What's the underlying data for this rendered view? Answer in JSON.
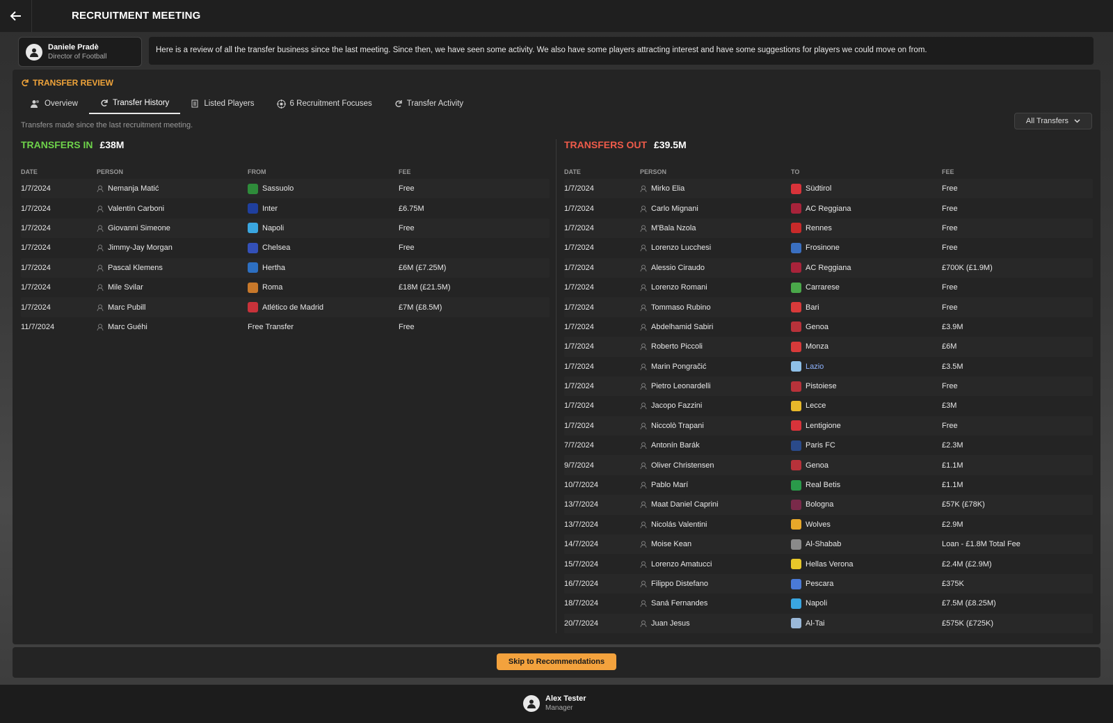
{
  "header": {
    "title": "RECRUITMENT MEETING"
  },
  "speaker": {
    "name": "Daniele Pradè",
    "role": "Director of Football",
    "message": "Here is a review of all the transfer business since the last meeting. Since then, we have seen some activity. We also have some players attracting interest and have some suggestions for players we could move on from."
  },
  "section": {
    "title": "TRANSFER REVIEW"
  },
  "tabs": [
    {
      "label": "Overview",
      "icon": "people-icon"
    },
    {
      "label": "Transfer History",
      "icon": "refresh-icon"
    },
    {
      "label": "Listed Players",
      "icon": "list-icon"
    },
    {
      "label": "6 Recruitment Focuses",
      "icon": "target-icon"
    },
    {
      "label": "Transfer Activity",
      "icon": "refresh-icon"
    }
  ],
  "subtitle": "Transfers made since the last recruitment meeting.",
  "filter": {
    "label": "All Transfers"
  },
  "transfers_in": {
    "label": "TRANSFERS IN",
    "total": "£38M",
    "headers": {
      "date": "DATE",
      "person": "PERSON",
      "club": "FROM",
      "fee": "FEE"
    },
    "rows": [
      {
        "date": "1/7/2024",
        "person": "Nemanja Matić",
        "club": "Sassuolo",
        "fee": "Free",
        "color": "#2e8b3a"
      },
      {
        "date": "1/7/2024",
        "person": "Valentín Carboni",
        "club": "Inter",
        "fee": "£6.75M",
        "color": "#1f3f9e"
      },
      {
        "date": "1/7/2024",
        "person": "Giovanni Simeone",
        "club": "Napoli",
        "fee": "Free",
        "color": "#3aa6e0"
      },
      {
        "date": "1/7/2024",
        "person": "Jimmy-Jay Morgan",
        "club": "Chelsea",
        "fee": "Free",
        "color": "#3350b8"
      },
      {
        "date": "1/7/2024",
        "person": "Pascal Klemens",
        "club": "Hertha",
        "fee": "£6M (£7.25M)",
        "color": "#2d6fc1"
      },
      {
        "date": "1/7/2024",
        "person": "Mile Svilar",
        "club": "Roma",
        "fee": "£18M (£21.5M)",
        "color": "#c7782a"
      },
      {
        "date": "1/7/2024",
        "person": "Marc Pubill",
        "club": "Atlético de Madrid",
        "fee": "£7M (£8.5M)",
        "color": "#c8323a"
      },
      {
        "date": "11/7/2024",
        "person": "Marc Guéhi",
        "club": "Free Transfer",
        "fee": "Free",
        "color": ""
      }
    ]
  },
  "transfers_out": {
    "label": "TRANSFERS OUT",
    "total": "£39.5M",
    "headers": {
      "date": "DATE",
      "person": "PERSON",
      "club": "TO",
      "fee": "FEE"
    },
    "rows": [
      {
        "date": "1/7/2024",
        "person": "Mirko Elia",
        "club": "Südtirol",
        "fee": "Free",
        "color": "#d8333a"
      },
      {
        "date": "1/7/2024",
        "person": "Carlo Mignani",
        "club": "AC Reggiana",
        "fee": "Free",
        "color": "#a8233a"
      },
      {
        "date": "1/7/2024",
        "person": "M'Bala Nzola",
        "club": "Rennes",
        "fee": "Free",
        "color": "#c82a2a"
      },
      {
        "date": "1/7/2024",
        "person": "Lorenzo Lucchesi",
        "club": "Frosinone",
        "fee": "Free",
        "color": "#3a6fc0"
      },
      {
        "date": "1/7/2024",
        "person": "Alessio Ciraudo",
        "club": "AC Reggiana",
        "fee": "£700K (£1.9M)",
        "color": "#a8233a"
      },
      {
        "date": "1/7/2024",
        "person": "Lorenzo Romani",
        "club": "Carrarese",
        "fee": "Free",
        "color": "#4aa84a"
      },
      {
        "date": "1/7/2024",
        "person": "Tommaso Rubino",
        "club": "Bari",
        "fee": "Free",
        "color": "#d83a3a"
      },
      {
        "date": "1/7/2024",
        "person": "Abdelhamid Sabiri",
        "club": "Genoa",
        "fee": "£3.9M",
        "color": "#b8323a"
      },
      {
        "date": "1/7/2024",
        "person": "Roberto Piccoli",
        "club": "Monza",
        "fee": "£6M",
        "color": "#d83a3a"
      },
      {
        "date": "1/7/2024",
        "person": "Marin Pongračić",
        "club": "Lazio",
        "fee": "£3.5M",
        "color": "#8fc0e8",
        "link": true
      },
      {
        "date": "1/7/2024",
        "person": "Pietro Leonardelli",
        "club": "Pistoiese",
        "fee": "Free",
        "color": "#b8323a"
      },
      {
        "date": "1/7/2024",
        "person": "Jacopo Fazzini",
        "club": "Lecce",
        "fee": "£3M",
        "color": "#e8b82a"
      },
      {
        "date": "1/7/2024",
        "person": "Niccolò Trapani",
        "club": "Lentigione",
        "fee": "Free",
        "color": "#d8333a"
      },
      {
        "date": "7/7/2024",
        "person": "Antonín Barák",
        "club": "Paris FC",
        "fee": "£2.3M",
        "color": "#2a4a8a"
      },
      {
        "date": "9/7/2024",
        "person": "Oliver Christensen",
        "club": "Genoa",
        "fee": "£1.1M",
        "color": "#b8323a"
      },
      {
        "date": "10/7/2024",
        "person": "Pablo Marí",
        "club": "Real Betis",
        "fee": "£1.1M",
        "color": "#2a9a4a"
      },
      {
        "date": "13/7/2024",
        "person": "Maat Daniel Caprini",
        "club": "Bologna",
        "fee": "£57K (£78K)",
        "color": "#7a2a4a"
      },
      {
        "date": "13/7/2024",
        "person": "Nicolás Valentini",
        "club": "Wolves",
        "fee": "£2.9M",
        "color": "#e8a82a"
      },
      {
        "date": "14/7/2024",
        "person": "Moise Kean",
        "club": "Al-Shabab",
        "fee": "Loan - £1.8M Total Fee",
        "color": "#8a8a8a"
      },
      {
        "date": "15/7/2024",
        "person": "Lorenzo Amatucci",
        "club": "Hellas Verona",
        "fee": "£2.4M (£2.9M)",
        "color": "#e8c82a"
      },
      {
        "date": "16/7/2024",
        "person": "Filippo Distefano",
        "club": "Pescara",
        "fee": "£375K",
        "color": "#4a7ad8"
      },
      {
        "date": "18/7/2024",
        "person": "Saná Fernandes",
        "club": "Napoli",
        "fee": "£7.5M (£8.25M)",
        "color": "#3aa6e0"
      },
      {
        "date": "20/7/2024",
        "person": "Juan Jesus",
        "club": "Al-Tai",
        "fee": "£575K (£725K)",
        "color": "#9ab8d8"
      }
    ]
  },
  "footer": {
    "skip_label": "Skip to Recommendations"
  },
  "user": {
    "name": "Alex Tester",
    "role": "Manager"
  }
}
